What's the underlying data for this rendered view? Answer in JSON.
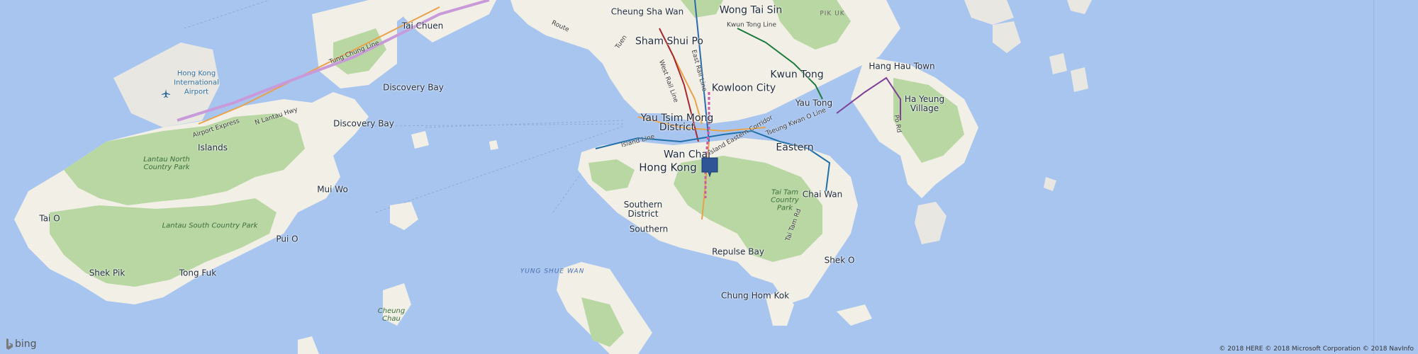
{
  "map": {
    "type": "road-map",
    "provider": "bing",
    "colors": {
      "water": "#a8c5ef",
      "land": "#f2efe6",
      "park": "#b9d7a3",
      "metro": "#c89ad9",
      "pin": "#2f5597"
    }
  },
  "labels": {
    "cheung_sha_wan": "Cheung Sha Wan",
    "wong_tai_sin": "Wong Tai Sin",
    "pik_uk": "PIK UK",
    "sham_shui_po": "Sham Shui Po",
    "kwun_tong_line": "Kwun Tong Line",
    "tai_chuen": "Tai Chuen",
    "kwun_tong": "Kwun Tong",
    "hang_hau_town": "Hang Hau Town",
    "tung_chung_line": "Tung Chung Line",
    "airport": "Hong Kong International Airport",
    "discovery_bay_1": "Discovery Bay",
    "kowloon_city": "Kowloon City",
    "ha_yeung_village": "Ha Yeung Village",
    "yau_tong": "Yau Tong",
    "west_rail_line": "West Rail Line",
    "east_rail_line": "East Rail Line",
    "airport_express": "Airport Express",
    "n_lantau_hwy": "N Lantau Hwy",
    "discovery_bay_2": "Discovery Bay",
    "yau_tsim_mong": "Yau Tsim Mong District",
    "islands": "Islands",
    "island_line": "Island Line",
    "tseung_kwan_o_line": "Tseung Kwan O Line",
    "eastern_corridor": "Island Eastern Corridor",
    "lantau_north_cp": "Lantau North Country Park",
    "wan_chai": "Wan Chai",
    "eastern": "Eastern",
    "hong_kong": "Hong Kong",
    "mui_wo": "Mui Wo",
    "chai_wan": "Chai Wan",
    "tai_tam_cp": "Tai Tam Country Park",
    "tai_tam_rd": "Tai Tam Rd",
    "southern_district": "Southern District",
    "tai_o": "Tai O",
    "lantau_south_cp": "Lantau South Country Park",
    "southern": "Southern",
    "pui_o": "Pui O",
    "repulse_bay": "Repulse Bay",
    "shek_o": "Shek O",
    "shek_pik": "Shek Pik",
    "tong_fuk": "Tong Fuk",
    "yung_shue_wan": "YUNG SHUE WAN",
    "chung_hom_kok": "Chung Hom Kok",
    "cheung_chau": "Cheung Chau",
    "po_rd": "Po Rd",
    "tuen_line": "Tuen",
    "route": "Route"
  },
  "logo": {
    "text": "bing"
  },
  "attribution": "© 2018 HERE © 2018 Microsoft Corporation © 2018 NavInfo"
}
